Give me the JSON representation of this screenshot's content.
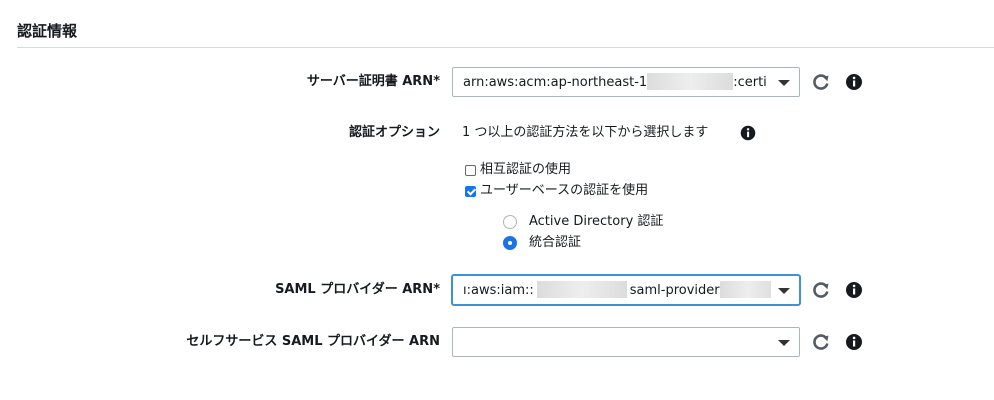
{
  "section": {
    "title": "認証情報"
  },
  "server_cert": {
    "label": "サーバー証明書 ARN*",
    "value_prefix": "arn:aws:acm:ap-northeast-1",
    "value_suffix": ":certi"
  },
  "auth_options": {
    "label": "認証オプション",
    "description": "1 つ以上の認証方法を以下から選択します",
    "mutual_auth": {
      "label": "相互認証の使用",
      "checked": false
    },
    "user_based": {
      "label": "ユーザーベースの認証を使用",
      "checked": true
    },
    "radio_options": [
      {
        "label": "Active Directory 認証",
        "selected": false
      },
      {
        "label": "統合認証",
        "selected": true
      }
    ]
  },
  "saml_provider": {
    "label": "SAML プロバイダー ARN*",
    "value_prefix": "ı:aws:iam::",
    "value_middle": "saml-provider"
  },
  "self_service_saml": {
    "label": "セルフサービス SAML プロバイダー ARN",
    "value": ""
  },
  "icons": {
    "refresh": "refresh-icon",
    "info": "info-icon",
    "caret": "chevron-down-icon"
  },
  "colors": {
    "accent": "#1a73e8",
    "focus_border": "#3f90d4",
    "text": "#16191f"
  }
}
